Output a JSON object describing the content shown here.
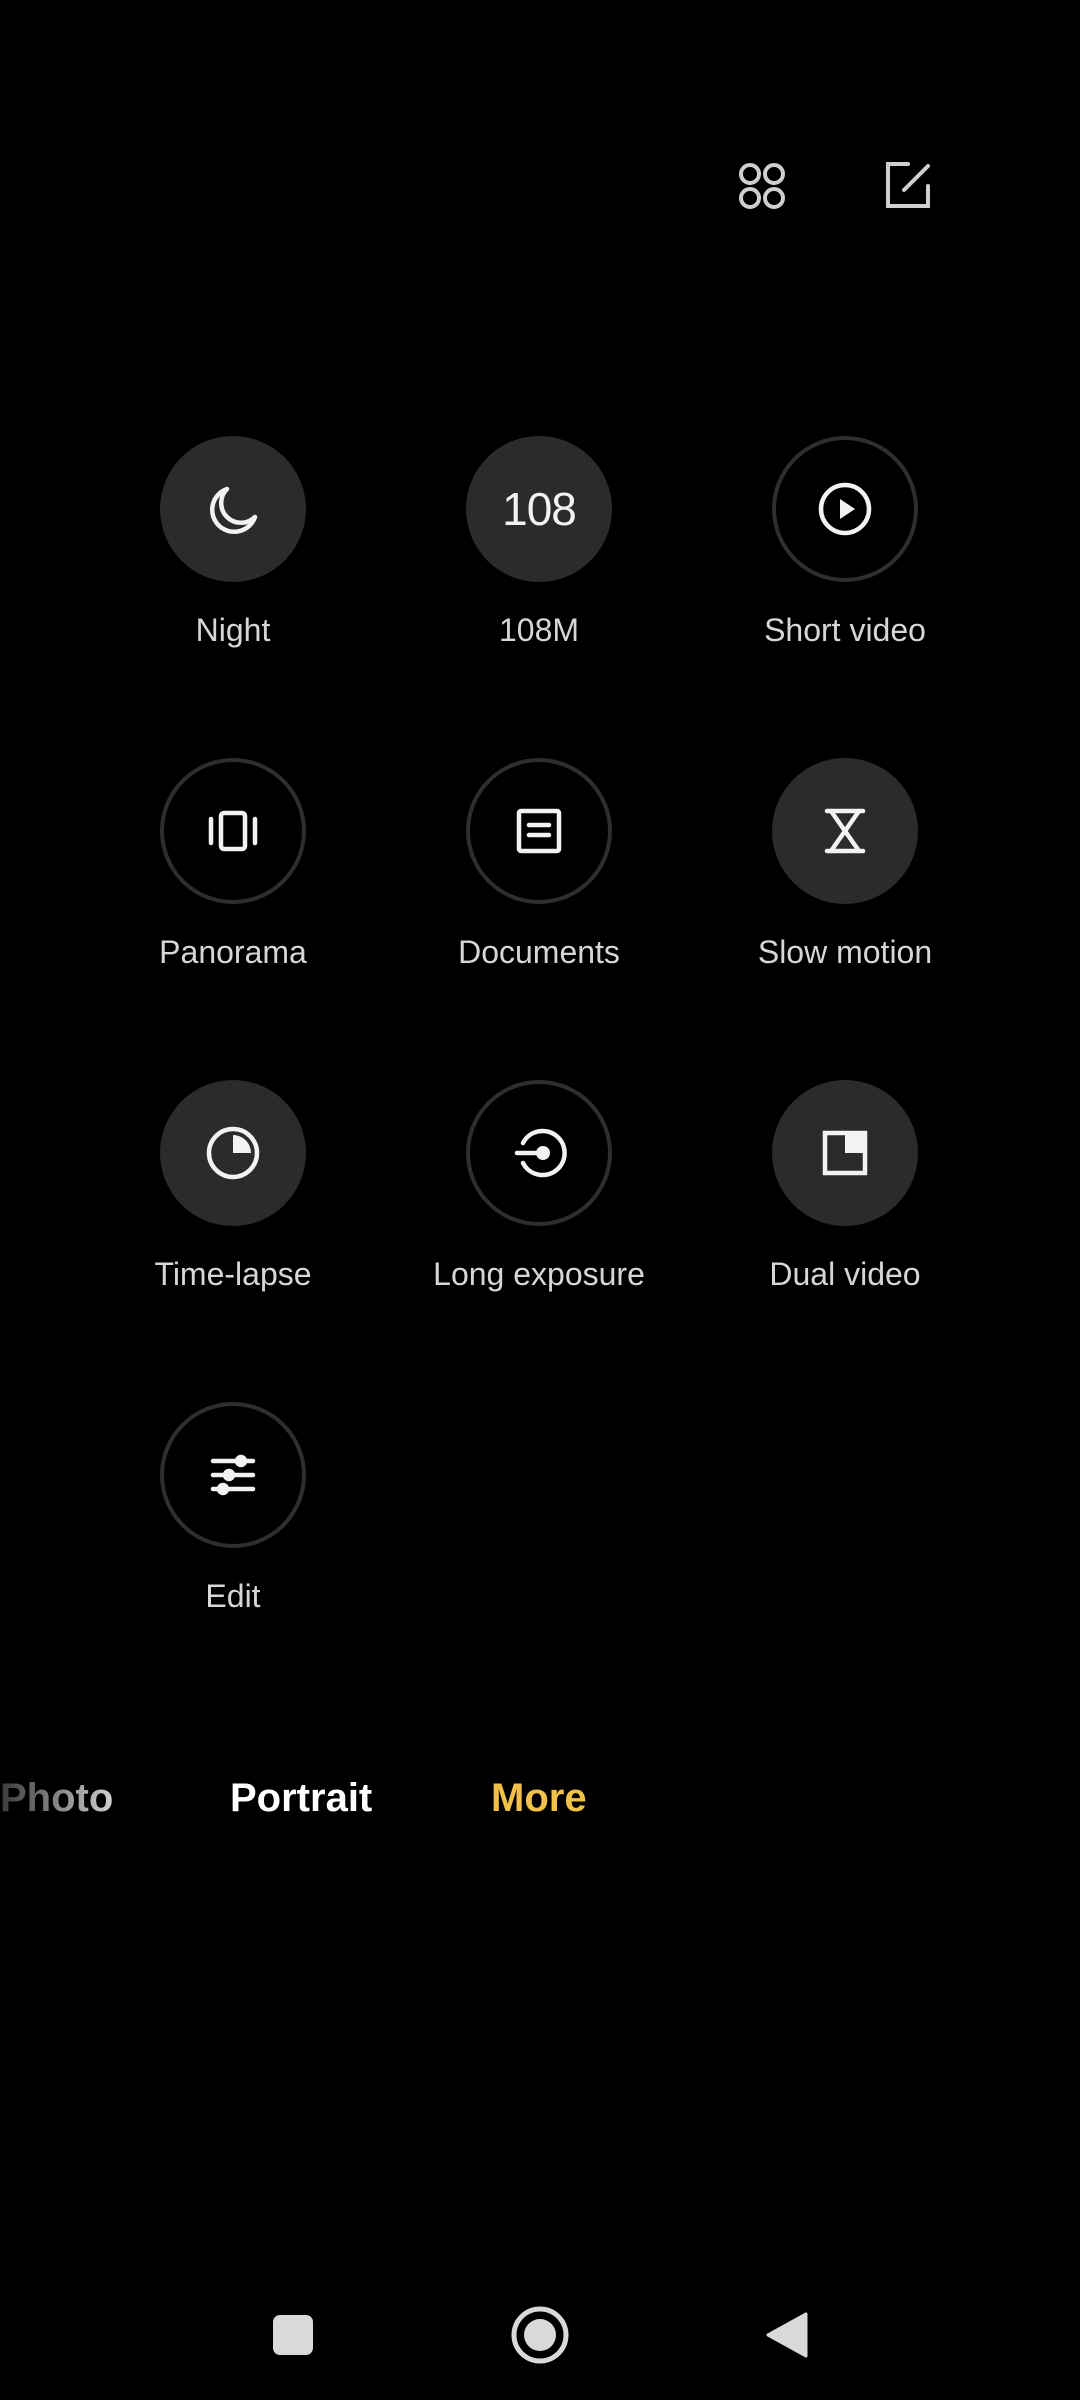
{
  "top_bar": {
    "icons": [
      {
        "name": "grid-icon"
      },
      {
        "name": "edit-icon"
      }
    ]
  },
  "modes": [
    {
      "label": "Night",
      "icon": "moon-icon",
      "style": "filled"
    },
    {
      "label": "108M",
      "icon": "108-text-icon",
      "glyph": "108",
      "style": "filled"
    },
    {
      "label": "Short video",
      "icon": "play-circle-icon",
      "style": "outlined"
    },
    {
      "label": "Panorama",
      "icon": "panorama-icon",
      "style": "outlined"
    },
    {
      "label": "Documents",
      "icon": "document-icon",
      "style": "outlined"
    },
    {
      "label": "Slow motion",
      "icon": "hourglass-icon",
      "style": "filled"
    },
    {
      "label": "Time-lapse",
      "icon": "timelapse-icon",
      "style": "filled"
    },
    {
      "label": "Long exposure",
      "icon": "long-exposure-icon",
      "style": "outlined"
    },
    {
      "label": "Dual video",
      "icon": "dual-video-icon",
      "style": "filled"
    },
    {
      "label": "Edit",
      "icon": "sliders-icon",
      "style": "outlined"
    }
  ],
  "mode_switcher": {
    "tabs": [
      "Photo",
      "Portrait",
      "More"
    ],
    "active": "More"
  },
  "colors": {
    "background": "#000000",
    "active_tab": "#f2c14a",
    "circle_fill": "#2b2b2b"
  },
  "nav_bar": {
    "buttons": [
      "recents-square-icon",
      "home-circle-icon",
      "back-triangle-icon"
    ]
  }
}
